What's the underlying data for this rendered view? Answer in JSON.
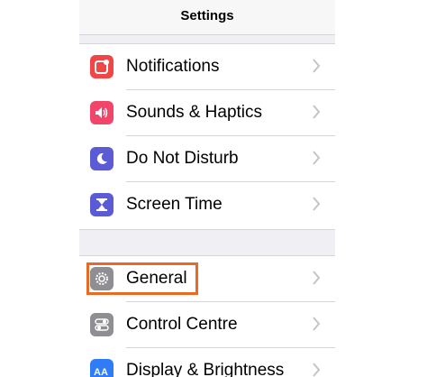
{
  "navbar": {
    "title": "Settings"
  },
  "group1": {
    "items": [
      {
        "label": "Notifications",
        "icon": "notifications-icon",
        "color": "#f04646"
      },
      {
        "label": "Sounds & Haptics",
        "icon": "speaker-icon",
        "color": "#f2456a"
      },
      {
        "label": "Do Not Disturb",
        "icon": "moon-icon",
        "color": "#5b5bd6"
      },
      {
        "label": "Screen Time",
        "icon": "hourglass-icon",
        "color": "#5b5bd6"
      }
    ]
  },
  "group2": {
    "items": [
      {
        "label": "General",
        "icon": "gear-icon",
        "color": "#8e8e93",
        "highlighted": true
      },
      {
        "label": "Control Centre",
        "icon": "toggles-icon",
        "color": "#8e8e93"
      },
      {
        "label": "Display & Brightness",
        "icon": "text-size-icon",
        "color": "#2f7cf6"
      }
    ]
  }
}
